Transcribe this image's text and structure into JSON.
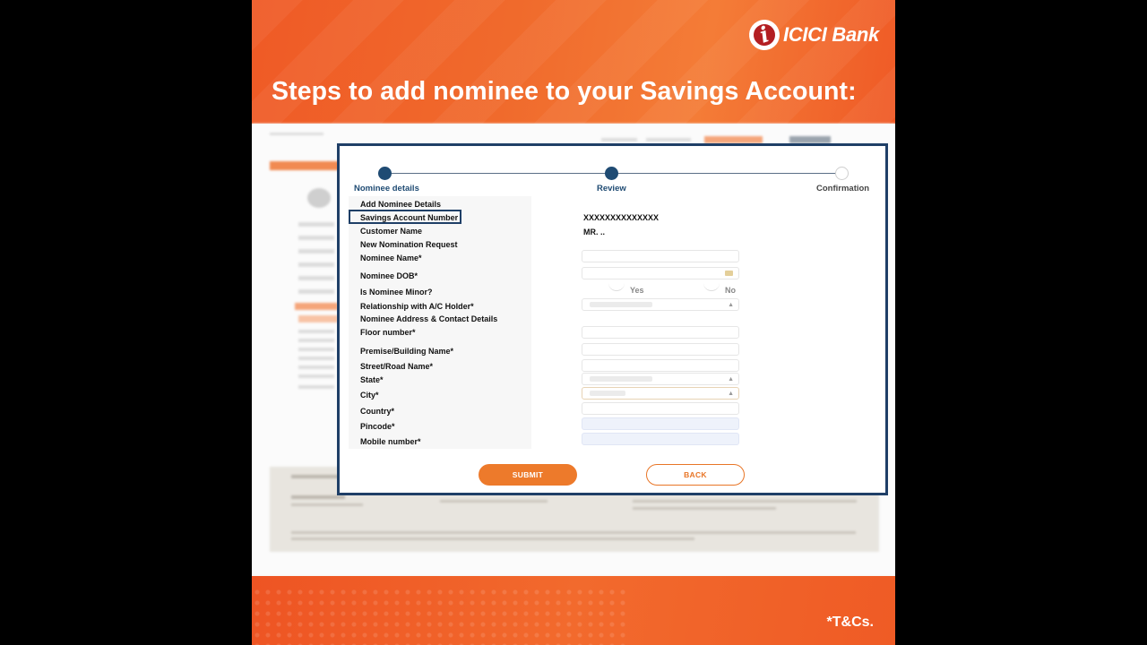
{
  "brand": {
    "logo_glyph": "i",
    "name": "ICICI Bank",
    "primary_color": "#ef5a26",
    "navy_color": "#1f3f67"
  },
  "headline": "Steps to add nominee to your Savings Account:",
  "footer": {
    "tnc": "*T&Cs."
  },
  "stepper": {
    "steps": [
      {
        "label": "Nominee details",
        "state": "active"
      },
      {
        "label": "Review",
        "state": "active"
      },
      {
        "label": "Confirmation",
        "state": "pending"
      }
    ]
  },
  "form": {
    "section_title": "Add Nominee Details",
    "account_label": "Savings Account Number",
    "account_value": "XXXXXXXXXXXXXX",
    "customer_label": "Customer Name",
    "customer_value": "MR. ..",
    "request_title": "New Nomination Request",
    "nominee_name_label": "Nominee Name*",
    "nominee_dob_label": "Nominee DOB*",
    "minor_label": "Is Nominee Minor?",
    "minor_yes": "Yes",
    "minor_no": "No",
    "relationship_label": "Relationship with A/C Holder*",
    "address_title": "Nominee Address & Contact Details",
    "floor_label": "Floor number*",
    "premise_label": "Premise/Building Name*",
    "street_label": "Street/Road Name*",
    "state_label": "State*",
    "city_label": "City*",
    "country_label": "Country*",
    "pincode_label": "Pincode*",
    "mobile_label": "Mobile number*",
    "submit_label": "SUBMIT",
    "back_label": "BACK"
  }
}
